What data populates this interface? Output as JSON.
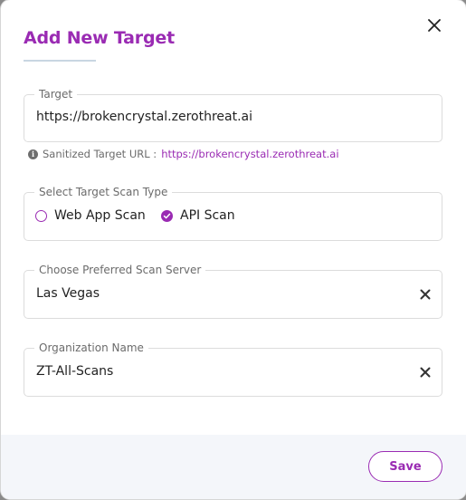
{
  "dialog": {
    "title": "Add New Target",
    "close_icon": "close-icon"
  },
  "target": {
    "label": "Target",
    "value": "https://brokencrystal.zerothreat.ai"
  },
  "sanitized": {
    "label": "Sanitized Target URL :",
    "url": "https://brokencrystal.zerothreat.ai",
    "icon": "info-icon"
  },
  "scan_type": {
    "label": "Select Target Scan Type",
    "options": [
      {
        "label": "Web App Scan",
        "checked": false
      },
      {
        "label": "API Scan",
        "checked": true
      }
    ]
  },
  "scan_server": {
    "label": "Choose Preferred Scan Server",
    "value": "Las Vegas"
  },
  "organization": {
    "label": "Organization Name",
    "value": "ZT-All-Scans"
  },
  "footer": {
    "save_label": "Save"
  },
  "colors": {
    "accent": "#9a2bb3",
    "footer_bg": "#f4f6fa",
    "border": "#dcdcdc"
  }
}
